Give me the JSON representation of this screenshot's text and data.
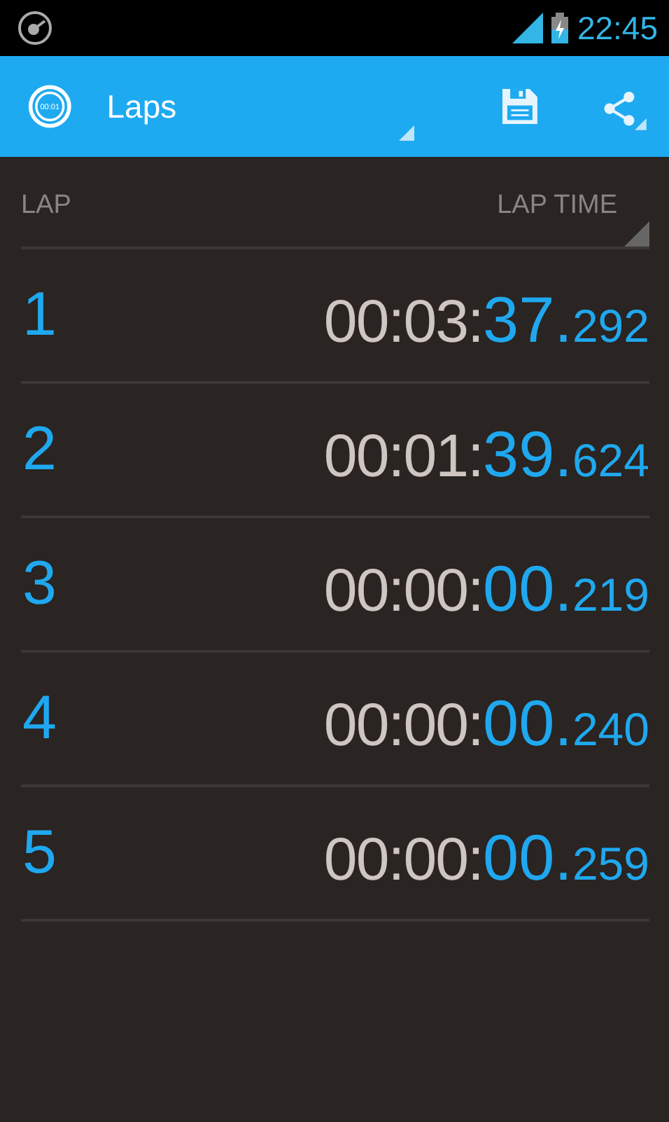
{
  "status_bar": {
    "time": "22:45"
  },
  "action_bar": {
    "logo_text": "00:01",
    "title": "Laps"
  },
  "table": {
    "columns": [
      "LAP",
      "LAP TIME"
    ],
    "rows": [
      {
        "lap": "1",
        "time": [
          "00:03:",
          "37.",
          "292"
        ]
      },
      {
        "lap": "2",
        "time": [
          "00:01:",
          "39.",
          "624"
        ]
      },
      {
        "lap": "3",
        "time": [
          "00:00:",
          "00.",
          "219"
        ]
      },
      {
        "lap": "4",
        "time": [
          "00:00:",
          "00.",
          "240"
        ]
      },
      {
        "lap": "5",
        "time": [
          "00:00:",
          "00.",
          "259"
        ]
      }
    ]
  }
}
